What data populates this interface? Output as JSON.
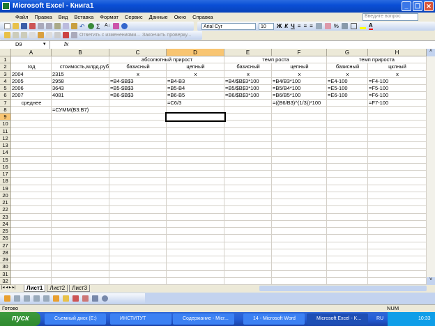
{
  "window": {
    "title": "Microsoft Excel - Книга1"
  },
  "menu": [
    "Файл",
    "Правка",
    "Вид",
    "Вставка",
    "Формат",
    "Сервис",
    "Данные",
    "Окно",
    "Справка"
  ],
  "ask_placeholder": "Введите вопрос",
  "toolbar": {
    "font": "Arial Cyr",
    "size": "10",
    "bold": "Ж",
    "italic": "К",
    "underline": "Ч",
    "percent": "%"
  },
  "review_toolbar": {
    "reply": "Ответить с изменениями...",
    "end_review": "Закончить проверку..."
  },
  "formula_bar": {
    "name_box": "D9",
    "fx": "fx",
    "value": ""
  },
  "columns": [
    "A",
    "B",
    "C",
    "D",
    "E",
    "F",
    "G",
    "H"
  ],
  "selected_column": "D",
  "selected_row": 9,
  "rows": [
    {
      "n": 1,
      "cells": {
        "C": "абсолютный прирост",
        "E": "темп роста",
        "G": "темп прироста"
      }
    },
    {
      "n": 2,
      "cells": {
        "A": "год",
        "B": "стоимость,млрд.руб",
        "C": "базисный",
        "D": "цепный",
        "E": "базисный",
        "F": "цепный",
        "G": "базисный",
        "H": "цклный"
      }
    },
    {
      "n": 3,
      "cells": {
        "A": "2004",
        "B": "2315",
        "C": "x",
        "D": "x",
        "E": "x",
        "F": "x",
        "G": "x",
        "H": "x"
      }
    },
    {
      "n": 4,
      "cells": {
        "A": "2005",
        "B": "2958",
        "C": "=B4-$B$3",
        "D": "=B4-B3",
        "E": "=B4/$B$3*100",
        "F": "=B4/B3*100",
        "G": "=E4-100",
        "H": "=F4-100"
      }
    },
    {
      "n": 5,
      "cells": {
        "A": "2006",
        "B": "3643",
        "C": "=B5-$B$3",
        "D": "=B5-B4",
        "E": "=B5/$B$3*100",
        "F": "=B5/B4*100",
        "G": "=E5-100",
        "H": "=F5-100"
      }
    },
    {
      "n": 6,
      "cells": {
        "A": "2007",
        "B": "4081",
        "C": "=B6-$B$3",
        "D": "=B6-B5",
        "E": "=B6/$B$3*100",
        "F": "=B6/B5*100",
        "G": "=E6-100",
        "H": "=F6-100"
      }
    },
    {
      "n": 7,
      "cells": {
        "A": "среднее",
        "D": "=C6/3",
        "F": "=((B6/B3)^(1/3))*100",
        "H": "=F7-100"
      }
    },
    {
      "n": 8,
      "cells": {
        "B": "=СУММ(B3:B7)"
      }
    }
  ],
  "row_count": 32,
  "sheets": [
    "Лист1",
    "Лист2",
    "Лист3"
  ],
  "active_sheet": "Лист1",
  "status": {
    "ready": "Готово",
    "num": "NUM"
  },
  "taskbar": {
    "start": "пуск",
    "tasks": [
      "Съемный диск (E:)",
      "ИНСТИТУТ",
      "Содержание - Micr...",
      "14 - Microsoft Word",
      "Microsoft Excel - K..."
    ],
    "lang": "RU",
    "clock": "10:33"
  }
}
